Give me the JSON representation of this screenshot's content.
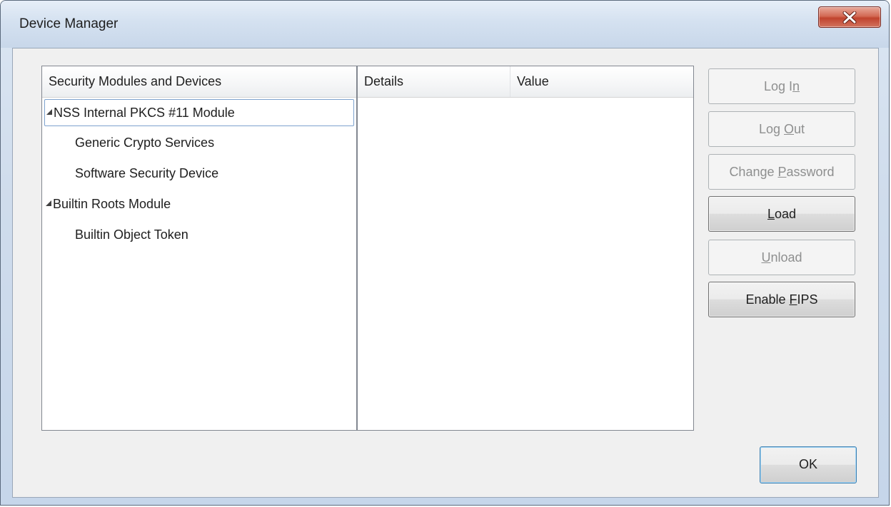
{
  "window": {
    "title": "Device Manager",
    "close_icon": "close-icon"
  },
  "tree": {
    "header": "Security Modules and Devices",
    "items": [
      {
        "label": "NSS Internal PKCS #11 Module",
        "level": 0,
        "expanded": true,
        "selected": true
      },
      {
        "label": "Generic Crypto Services",
        "level": 1
      },
      {
        "label": "Software Security Device",
        "level": 1
      },
      {
        "label": "Builtin Roots Module",
        "level": 0,
        "expanded": true
      },
      {
        "label": "Builtin Object Token",
        "level": 1
      }
    ]
  },
  "details": {
    "columns": [
      "Details",
      "Value"
    ],
    "rows": []
  },
  "buttons": {
    "login": {
      "pre": "Log I",
      "key": "n",
      "post": "",
      "enabled": false
    },
    "logout": {
      "pre": "Log ",
      "key": "O",
      "post": "ut",
      "enabled": false
    },
    "change_password": {
      "pre": "Change ",
      "key": "P",
      "post": "assword",
      "enabled": false
    },
    "load": {
      "pre": "",
      "key": "L",
      "post": "oad",
      "enabled": true
    },
    "unload": {
      "pre": "",
      "key": "U",
      "post": "nload",
      "enabled": false
    },
    "enable_fips": {
      "pre": "Enable ",
      "key": "F",
      "post": "IPS",
      "enabled": true
    },
    "ok": {
      "label": "OK",
      "enabled": true
    }
  },
  "colors": {
    "accent": "#3c7fb1",
    "close_button": "#c0432e"
  }
}
